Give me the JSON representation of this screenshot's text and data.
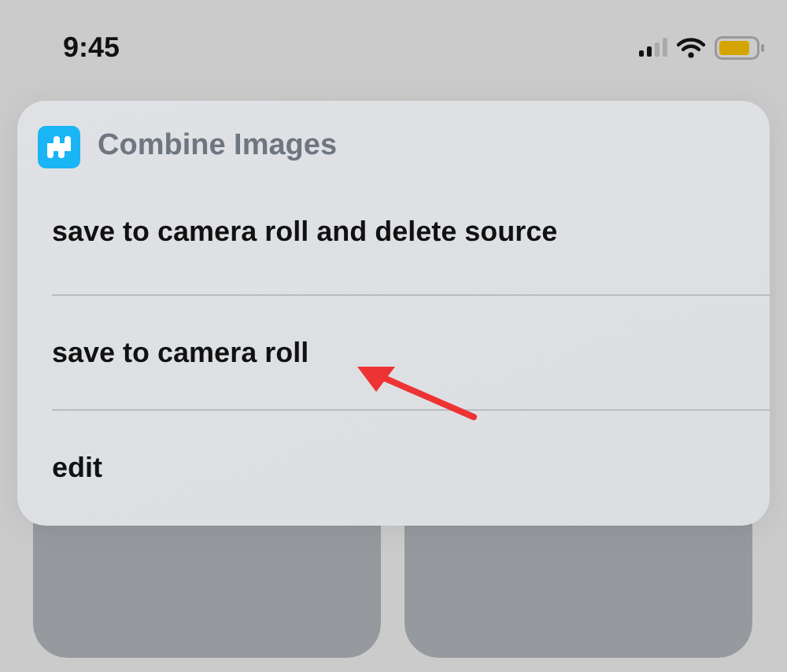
{
  "status_bar": {
    "time": "9:45"
  },
  "menu": {
    "title": "Combine Images",
    "items": [
      {
        "label": "save to camera roll and delete source"
      },
      {
        "label": "save to camera roll"
      },
      {
        "label": "edit"
      }
    ]
  }
}
